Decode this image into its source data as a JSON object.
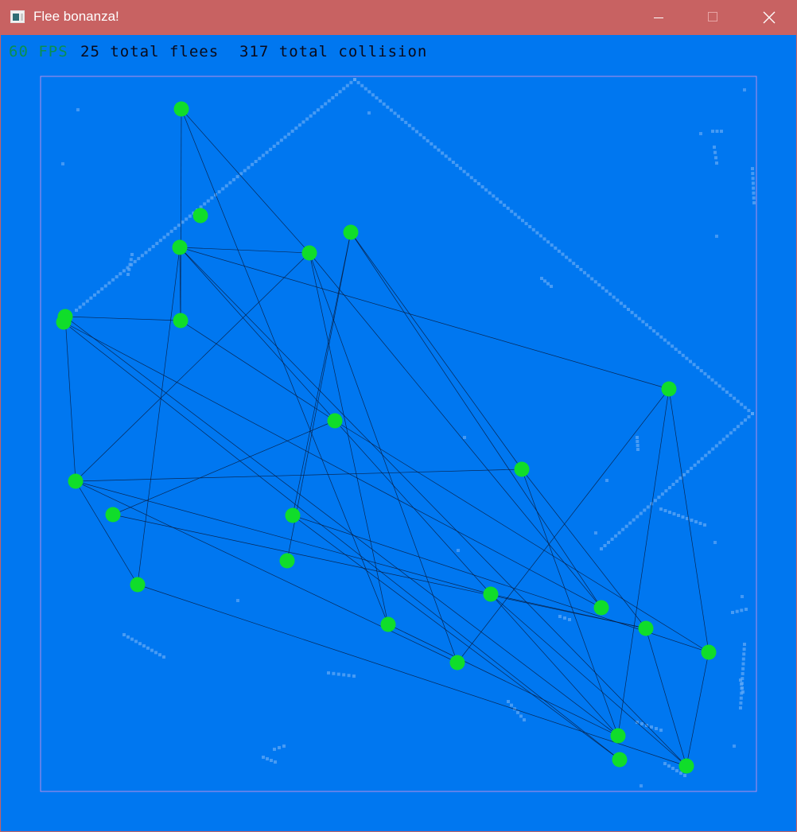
{
  "window": {
    "title": "Flee bonanza!",
    "icon": "app-window-icon",
    "controls": {
      "minimize": "minimize-icon",
      "maximize": "maximize-icon",
      "close": "close-icon"
    }
  },
  "hud": {
    "fps": "60 FPS",
    "flees": "25 total flees",
    "collisions": "317 total collision"
  },
  "colors": {
    "titlebar": "#c86262",
    "background": "#0077f0",
    "flee": "#10dd2a",
    "arena_border": "#b58ee6",
    "connection": "#0a1a3a",
    "trail": "#5fa7f5",
    "fps_text": "#0a8f50",
    "hud_text": "#0a0a1a"
  }
}
